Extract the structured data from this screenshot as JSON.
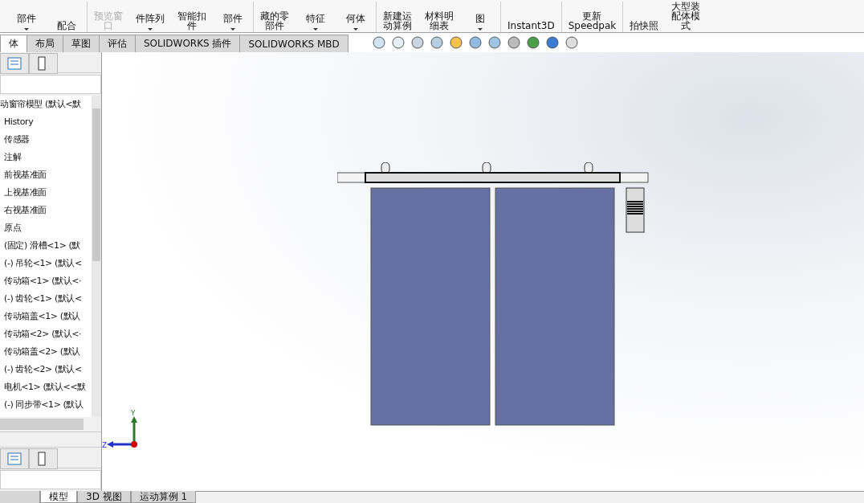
{
  "ribbon": [
    {
      "lines": [
        "部件"
      ],
      "caret": true,
      "disabled": false
    },
    {
      "lines": [
        "配合"
      ],
      "caret": false,
      "disabled": false
    },
    {
      "lines": [
        "预览窗",
        "口"
      ],
      "caret": false,
      "disabled": true
    },
    {
      "lines": [
        "件阵列"
      ],
      "caret": true,
      "disabled": false
    },
    {
      "lines": [
        "智能扣",
        "件"
      ],
      "caret": false,
      "disabled": false
    },
    {
      "lines": [
        "部件"
      ],
      "caret": true,
      "disabled": false
    },
    {
      "lines": [
        "藏的零",
        "部件"
      ],
      "caret": false,
      "disabled": false
    },
    {
      "lines": [
        "特征"
      ],
      "caret": true,
      "disabled": false
    },
    {
      "lines": [
        "何体"
      ],
      "caret": true,
      "disabled": false
    },
    {
      "lines": [
        "新建运",
        "动算例"
      ],
      "caret": false,
      "disabled": false
    },
    {
      "lines": [
        "材料明",
        "细表"
      ],
      "caret": false,
      "disabled": false
    },
    {
      "lines": [
        "图"
      ],
      "caret": true,
      "disabled": false
    },
    {
      "lines": [
        "Instant3D"
      ],
      "caret": false,
      "disabled": false
    },
    {
      "lines": [
        "更新",
        "Speedpak"
      ],
      "caret": false,
      "disabled": false
    },
    {
      "lines": [
        "拍快照"
      ],
      "caret": false,
      "disabled": false
    },
    {
      "lines": [
        "大型装",
        "配体模",
        "式"
      ],
      "caret": false,
      "disabled": false
    }
  ],
  "tabs": [
    {
      "label": "体",
      "selected": true
    },
    {
      "label": "布局",
      "selected": false
    },
    {
      "label": "草图",
      "selected": false
    },
    {
      "label": "评估",
      "selected": false
    },
    {
      "label": "SOLIDWORKS 插件",
      "selected": false
    },
    {
      "label": "SOLIDWORKS MBD",
      "selected": false
    }
  ],
  "tree": {
    "root": "动窗帘模型 (默认<默",
    "items": [
      "History",
      "传感器",
      "注解",
      "前视基准面",
      "上视基准面",
      "右视基准面",
      "原点",
      "(固定) 滑槽<1> (默",
      "(-) 吊轮<1> (默认<",
      "传动箱<1> (默认<·",
      "(-) 齿轮<1> (默认<",
      "传动箱盖<1> (默认",
      "传动箱<2> (默认<·",
      "传动箱盖<2> (默认",
      "(-) 齿轮<2> (默认<",
      "电机<1> (默认<<默",
      "(-) 同步带<1> (默认"
    ]
  },
  "triad": {
    "y": "Y",
    "z": "Z"
  },
  "bottom_tabs": [
    {
      "label": "模型",
      "selected": true
    },
    {
      "label": "3D 视图",
      "selected": false
    },
    {
      "label": "运动算例 1",
      "selected": false
    }
  ]
}
